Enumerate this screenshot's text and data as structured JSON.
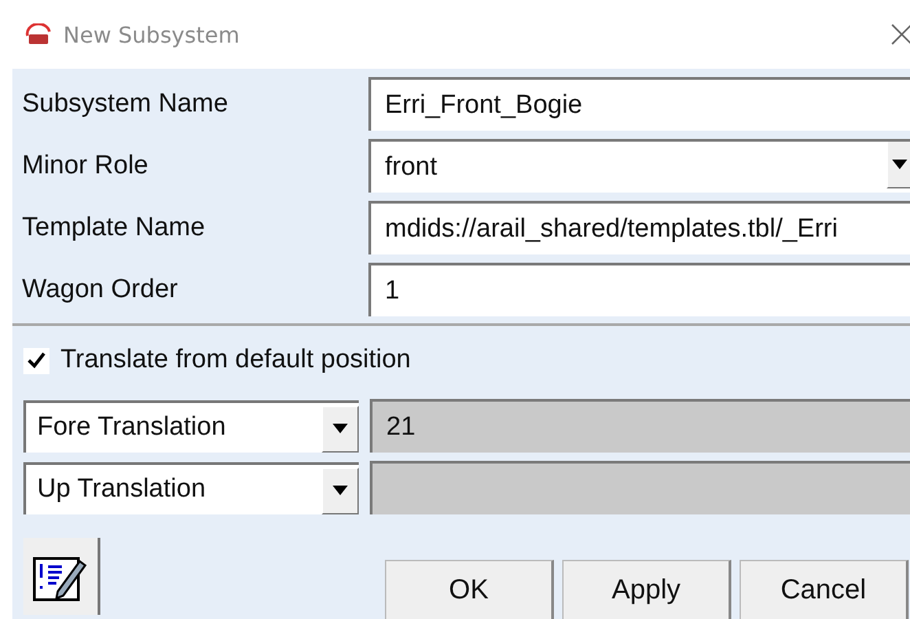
{
  "window": {
    "title": "New Subsystem"
  },
  "fields": [
    {
      "label": "Subsystem Name",
      "kind": "text",
      "value": "Erri_Front_Bogie"
    },
    {
      "label": "Minor Role",
      "kind": "dropdown",
      "value": "front"
    },
    {
      "label": "Template Name",
      "kind": "text",
      "value": "mdids://arail_shared/templates.tbl/_Erri"
    },
    {
      "label": "Wagon Order",
      "kind": "text",
      "value": "1"
    }
  ],
  "translate": {
    "label": "Translate from default position",
    "checked": true
  },
  "translations": [
    {
      "axis": "Fore Translation",
      "value": "21"
    },
    {
      "axis": "Up Translation"
    }
  ],
  "buttons": [
    "OK",
    "Apply",
    "Cancel"
  ]
}
